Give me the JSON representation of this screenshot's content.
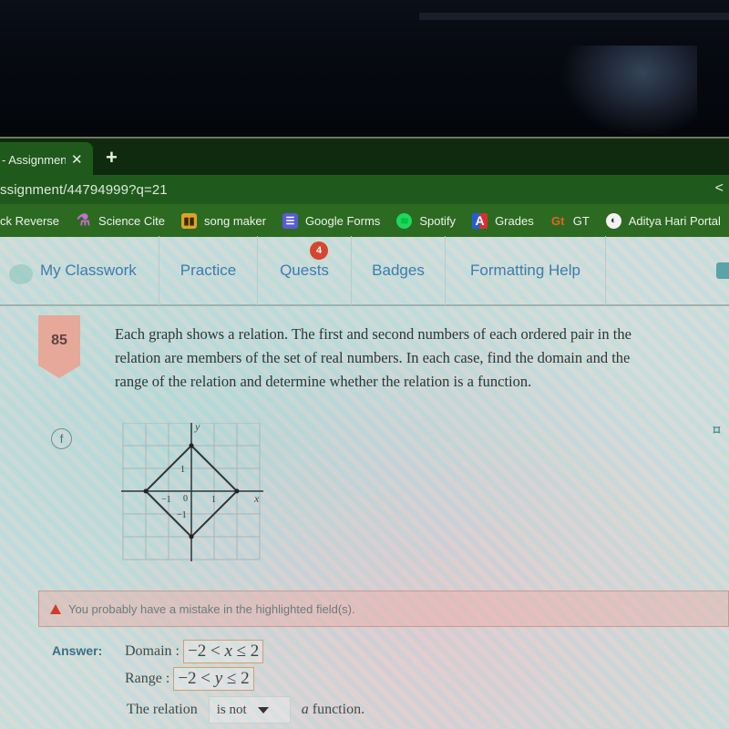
{
  "browser": {
    "tab_title": "- Assignmen",
    "tab_close": "✕",
    "new_tab": "+",
    "url": "ssignment/44794999?q=21",
    "share_icon": "<",
    "bookmarks": [
      {
        "label": "ck Reverse",
        "icon": "none"
      },
      {
        "label": "Science Cite",
        "icon": "flask-icon",
        "glyph": "⚗"
      },
      {
        "label": "song maker",
        "icon": "piano-icon",
        "glyph": "▮▮"
      },
      {
        "label": "Google Forms",
        "icon": "forms-icon",
        "glyph": "☰"
      },
      {
        "label": "Spotify",
        "icon": "spotify-icon",
        "glyph": "≋"
      },
      {
        "label": "Grades",
        "icon": "grades-icon",
        "glyph": "A"
      },
      {
        "label": "GT",
        "icon": "gt-icon",
        "glyph": "Gt"
      },
      {
        "label": "Aditya Hari Portal",
        "icon": "globe-icon",
        "glyph": "◐"
      }
    ]
  },
  "nav": {
    "items": [
      {
        "label": "My Classwork"
      },
      {
        "label": "Practice"
      },
      {
        "label": "Quests",
        "badge": "4"
      },
      {
        "label": "Badges"
      },
      {
        "label": "Formatting Help"
      }
    ]
  },
  "problem": {
    "number": "85",
    "prompt": "Each graph shows a relation. The first and second numbers of each ordered pair in the relation are members of the set of real numbers. In each case, find the domain and the range of the relation and determine whether the relation is a function.",
    "part": "f",
    "graph": {
      "x_label": "x",
      "y_label": "y",
      "x_ticks": [
        "−1",
        "0",
        "1"
      ],
      "y_ticks": [
        "1",
        "−1"
      ],
      "shape": "diamond",
      "vertices": [
        [
          0,
          2
        ],
        [
          2,
          0
        ],
        [
          0,
          -2
        ],
        [
          -2,
          0
        ]
      ],
      "grid_range": [
        -3,
        3
      ]
    }
  },
  "alert": {
    "icon": "warning-icon",
    "text": "You probably have a mistake in the highlighted field(s)."
  },
  "answer": {
    "label": "Answer:",
    "domain_label": "Domain :",
    "domain_value_pre": "−2 < ",
    "domain_var": "x",
    "domain_value_post": " ≤ 2",
    "range_label": "Range :",
    "range_value_pre": "−2 < ",
    "range_var": "y",
    "range_value_post": " ≤ 2",
    "relation_prefix": "The relation",
    "relation_select": "is not",
    "relation_suffix_a": "a",
    "relation_suffix": "function."
  }
}
